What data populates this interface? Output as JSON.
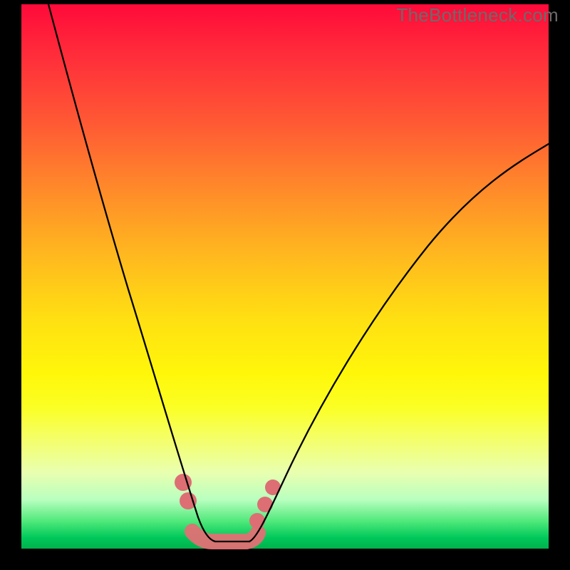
{
  "watermark": "TheBottleneck.com",
  "colors": {
    "gradient_top": "#ff0a3a",
    "gradient_bottom": "#00b24c",
    "curve": "#000000",
    "highlight": "#e07074",
    "background": "#000000"
  },
  "chart_data": {
    "type": "line",
    "title": "",
    "xlabel": "",
    "ylabel": "",
    "xlim": [
      0,
      100
    ],
    "ylim": [
      0,
      100
    ],
    "grid": false,
    "series": [
      {
        "name": "left-branch",
        "x": [
          5,
          8,
          12,
          16,
          20,
          24,
          26,
          28,
          30,
          32,
          34,
          35,
          36
        ],
        "y": [
          100,
          85,
          68,
          53,
          40,
          27,
          21,
          16,
          11,
          7,
          3,
          1,
          0
        ]
      },
      {
        "name": "valley",
        "x": [
          36,
          38,
          40,
          42,
          44
        ],
        "y": [
          0,
          0,
          0,
          0,
          0
        ]
      },
      {
        "name": "right-branch",
        "x": [
          44,
          46,
          50,
          55,
          60,
          66,
          72,
          80,
          88,
          96,
          100
        ],
        "y": [
          0,
          2,
          8,
          17,
          26,
          35,
          43,
          53,
          62,
          70,
          74
        ]
      }
    ],
    "highlight_dots": [
      {
        "x": 30.5,
        "y": 10
      },
      {
        "x": 31.5,
        "y": 7
      },
      {
        "x": 44.5,
        "y": 3
      },
      {
        "x": 46.0,
        "y": 6
      },
      {
        "x": 47.5,
        "y": 9
      }
    ],
    "highlight_segment": {
      "from_x": 33,
      "to_x": 45,
      "y": 0
    }
  }
}
